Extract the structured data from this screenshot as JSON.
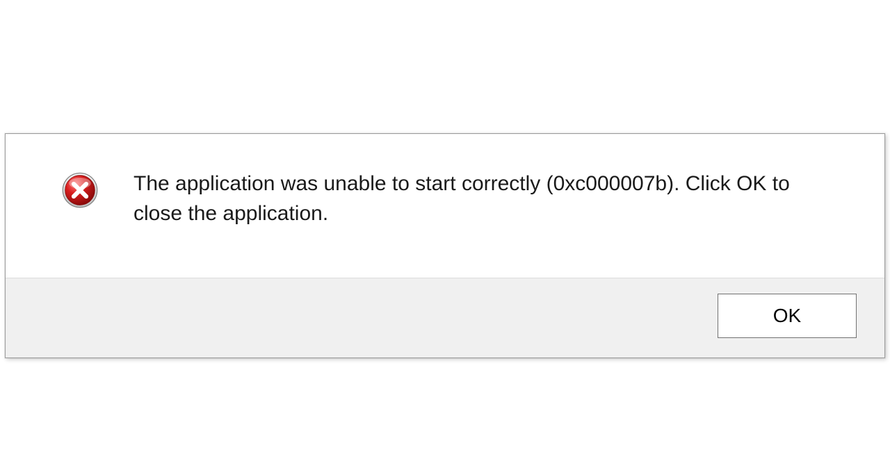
{
  "dialog": {
    "message": "The application was unable to start correctly (0xc000007b). Click OK to close the application.",
    "ok_label": "OK",
    "icon_name": "error-icon"
  }
}
